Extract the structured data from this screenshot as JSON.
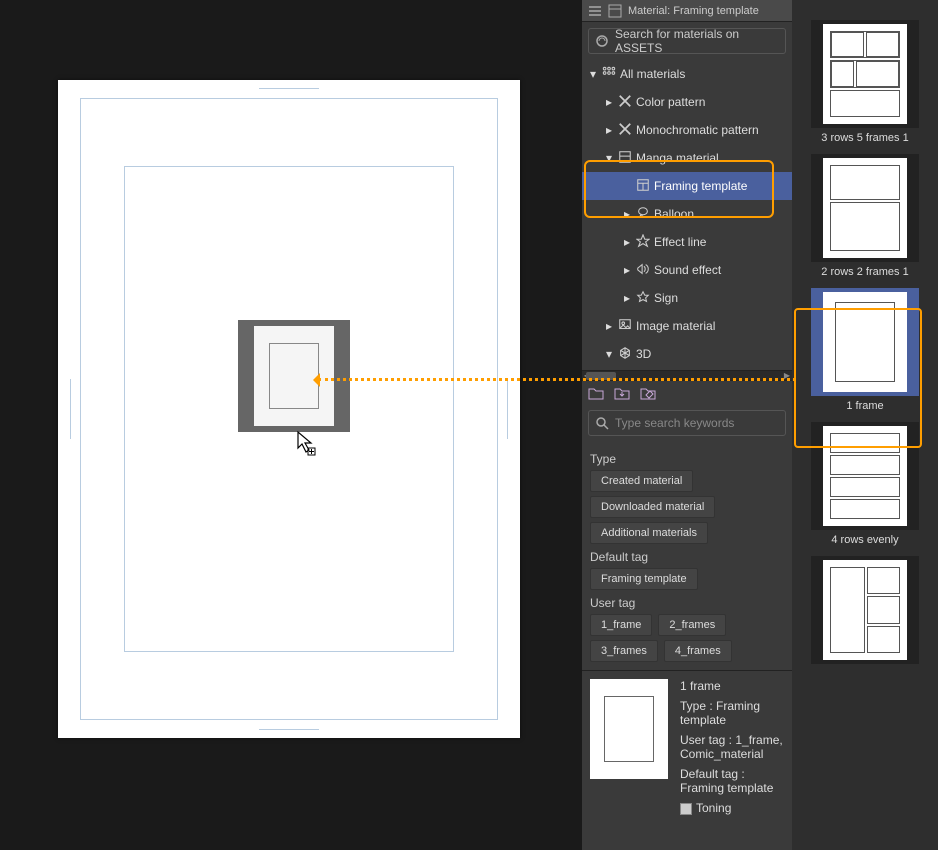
{
  "panel": {
    "tab_label": "Material: Framing template",
    "search_assets": "Search for materials on ASSETS",
    "search_placeholder": "Type search keywords"
  },
  "tree": [
    {
      "label": "All materials",
      "indent": 0,
      "expanded": true,
      "icon": "grid"
    },
    {
      "label": "Color pattern",
      "indent": 1,
      "expanded": false,
      "icon": "pattern"
    },
    {
      "label": "Monochromatic pattern",
      "indent": 1,
      "expanded": false,
      "icon": "pattern"
    },
    {
      "label": "Manga material",
      "indent": 1,
      "expanded": true,
      "icon": "manga"
    },
    {
      "label": "Framing template",
      "indent": 2,
      "expanded": null,
      "icon": "frame",
      "selected": true
    },
    {
      "label": "Balloon",
      "indent": 2,
      "expanded": false,
      "icon": "balloon"
    },
    {
      "label": "Effect line",
      "indent": 2,
      "expanded": false,
      "icon": "effect"
    },
    {
      "label": "Sound effect",
      "indent": 2,
      "expanded": false,
      "icon": "sound"
    },
    {
      "label": "Sign",
      "indent": 2,
      "expanded": false,
      "icon": "sign"
    },
    {
      "label": "Image material",
      "indent": 1,
      "expanded": false,
      "icon": "image"
    },
    {
      "label": "3D",
      "indent": 1,
      "expanded": true,
      "icon": "3d"
    }
  ],
  "filters": {
    "type_title": "Type",
    "type_tags": [
      "Created material",
      "Downloaded material",
      "Additional materials"
    ],
    "default_tag_title": "Default tag",
    "default_tags": [
      "Framing template"
    ],
    "user_tag_title": "User tag",
    "user_tags_row1": [
      "1_frame",
      "2_frames"
    ],
    "user_tags_row2": [
      "3_frames",
      "4_frames"
    ]
  },
  "thumbs": [
    {
      "name": "3 rows 5 frames 1",
      "layout": "3r5f"
    },
    {
      "name": "2 rows 2 frames 1",
      "layout": "2r2f"
    },
    {
      "name": "1 frame",
      "layout": "1f",
      "selected": true
    },
    {
      "name": "4 rows evenly",
      "layout": "4r"
    },
    {
      "name": "",
      "layout": "mix"
    }
  ],
  "detail": {
    "name": "1 frame",
    "type_line": "Type : Framing template",
    "user_tag_line": "User tag : 1_frame, Comic_material",
    "default_tag_line": "Default tag : Framing template",
    "toning_label": "Toning"
  }
}
